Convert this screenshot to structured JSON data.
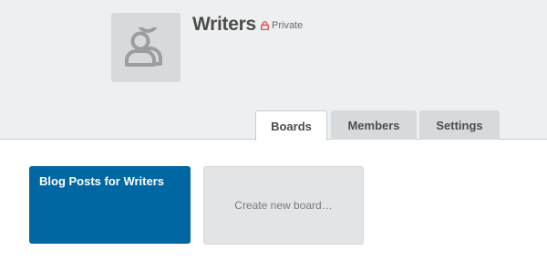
{
  "org": {
    "name": "Writers",
    "visibility": "Private",
    "avatar_icon": "group-icon",
    "lock_icon": "lock-icon",
    "lock_color": "#e2534b"
  },
  "tabs": [
    {
      "label": "Boards",
      "active": true
    },
    {
      "label": "Members",
      "active": false
    },
    {
      "label": "Settings",
      "active": false
    }
  ],
  "boards": [
    {
      "title": "Blog Posts for Writers",
      "color": "#0067a3"
    }
  ],
  "create_board": {
    "label": "Create new board…"
  }
}
